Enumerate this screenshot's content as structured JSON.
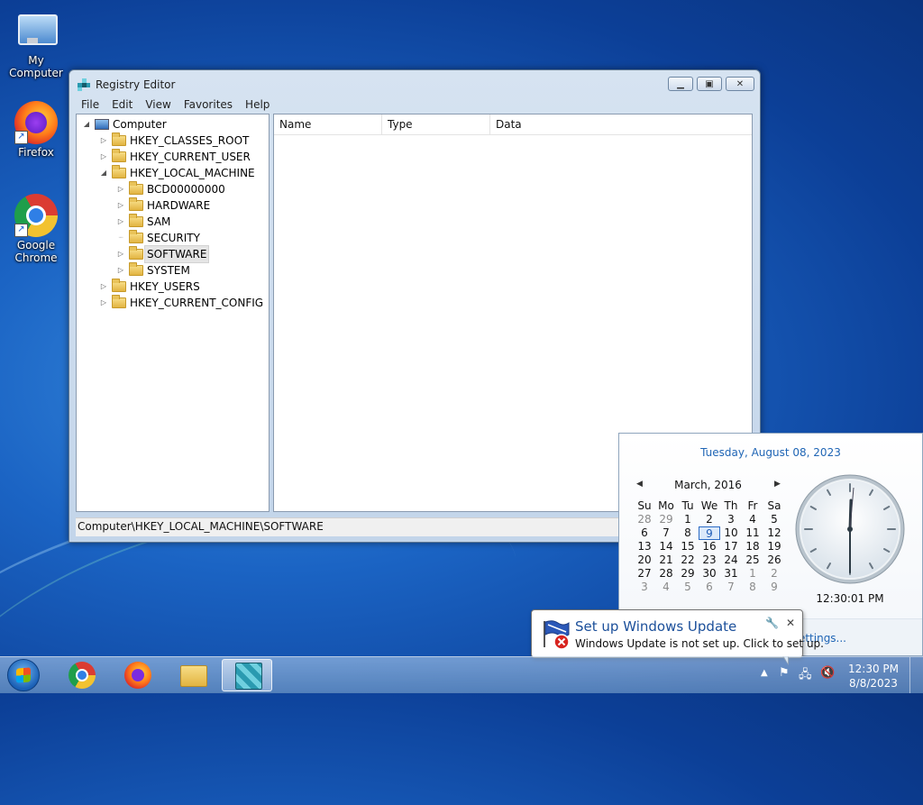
{
  "desktop": {
    "icons": [
      {
        "label": "My Computer"
      },
      {
        "label": "Firefox"
      },
      {
        "label": "Google\nChrome"
      }
    ]
  },
  "regedit": {
    "title": "Registry Editor",
    "menu": [
      "File",
      "Edit",
      "View",
      "Favorites",
      "Help"
    ],
    "tree": {
      "root": "Computer",
      "hives": [
        "HKEY_CLASSES_ROOT",
        "HKEY_CURRENT_USER",
        "HKEY_LOCAL_MACHINE",
        "HKEY_USERS",
        "HKEY_CURRENT_CONFIG"
      ],
      "hklm_children": [
        "BCD00000000",
        "HARDWARE",
        "SAM",
        "SECURITY",
        "SOFTWARE",
        "SYSTEM"
      ],
      "selected": "SOFTWARE"
    },
    "columns": [
      "Name",
      "Type",
      "Data"
    ],
    "status_path": "Computer\\HKEY_LOCAL_MACHINE\\SOFTWARE"
  },
  "calendar": {
    "long_date": "Tuesday, August 08, 2023",
    "month_label": "March, 2016",
    "weekdays": [
      "Su",
      "Mo",
      "Tu",
      "We",
      "Th",
      "Fr",
      "Sa"
    ],
    "weeks": [
      [
        "28",
        "29",
        "1",
        "2",
        "3",
        "4",
        "5"
      ],
      [
        "6",
        "7",
        "8",
        "9",
        "10",
        "11",
        "12"
      ],
      [
        "13",
        "14",
        "15",
        "16",
        "17",
        "18",
        "19"
      ],
      [
        "20",
        "21",
        "22",
        "23",
        "24",
        "25",
        "26"
      ],
      [
        "27",
        "28",
        "29",
        "30",
        "31",
        "1",
        "2"
      ],
      [
        "3",
        "4",
        "5",
        "6",
        "7",
        "8",
        "9"
      ]
    ],
    "selected_day": "9",
    "clock_time": "12:30:01 PM",
    "footer_link": "settings..."
  },
  "notification": {
    "title": "Set up Windows Update",
    "message": "Windows Update is not set up. Click to set up."
  },
  "taskbar": {
    "time": "12:30 PM",
    "date": "8/8/2023",
    "apps": [
      "chrome-icon",
      "firefox-icon",
      "file-explorer-icon",
      "registry-editor-icon"
    ]
  },
  "colors": {
    "accent": "#1f65b5",
    "window_frame": "#c3d5ea"
  }
}
